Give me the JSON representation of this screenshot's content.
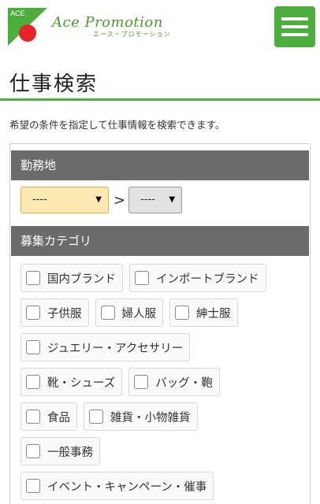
{
  "header": {
    "logo_text": "ACE",
    "brand_name": "Ace Promotion",
    "brand_sub": "エース・プロモーション",
    "menu_icon": "hamburger-menu-icon"
  },
  "page": {
    "title": "仕事検索",
    "description": "希望の条件を指定して仕事情報を検索できます。"
  },
  "search": {
    "location": {
      "header": "勤務地",
      "prefecture_value": "----",
      "separator": ">",
      "city_value": "----"
    },
    "category": {
      "header": "募集カテゴリ",
      "rows": [
        [
          "国内ブランド",
          "インポートブランド"
        ],
        [
          "子供服",
          "婦人服",
          "紳士服"
        ],
        [
          "ジュエリー・アクセサリー"
        ],
        [
          "靴・シューズ",
          "バッグ・鞄"
        ],
        [
          "食品",
          "雑貨・小物雑貨"
        ],
        [
          "一般事務"
        ],
        [
          "イベント・キャンペーン・催事"
        ]
      ]
    }
  },
  "colors": {
    "accent_green": "#4cae3c",
    "section_header_bg": "#6b6b6b",
    "prefecture_select_bg": "#fde9b2"
  }
}
